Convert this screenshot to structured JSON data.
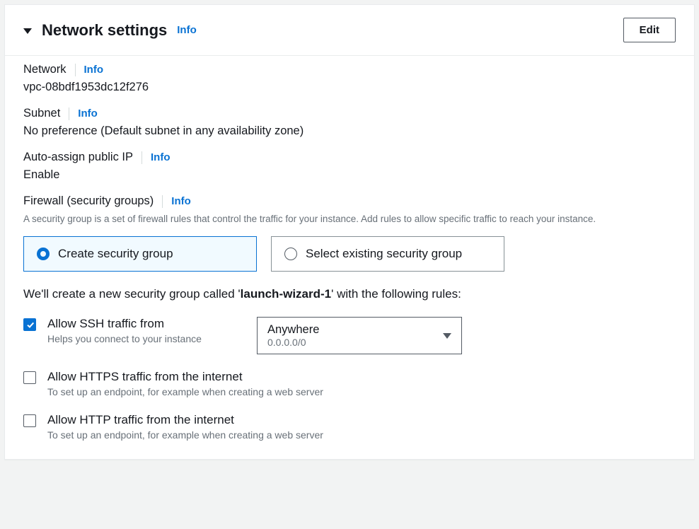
{
  "header": {
    "title": "Network settings",
    "info": "Info",
    "edit": "Edit"
  },
  "network": {
    "label": "Network",
    "info": "Info",
    "value": "vpc-08bdf1953dc12f276"
  },
  "subnet": {
    "label": "Subnet",
    "info": "Info",
    "value": "No preference (Default subnet in any availability zone)"
  },
  "publicIp": {
    "label": "Auto-assign public IP",
    "info": "Info",
    "value": "Enable"
  },
  "firewall": {
    "label": "Firewall (security groups)",
    "info": "Info",
    "desc": "A security group is a set of firewall rules that control the traffic for your instance. Add rules to allow specific traffic to reach your instance."
  },
  "sgOptions": {
    "create": "Create security group",
    "select": "Select existing security group"
  },
  "sgNote": {
    "prefix": "We'll create a new security group called '",
    "name": "launch-wizard-1",
    "suffix": "' with the following rules:"
  },
  "rules": {
    "ssh": {
      "label": "Allow SSH traffic from",
      "desc": "Helps you connect to your instance",
      "source": "Anywhere",
      "sourceDetail": "0.0.0.0/0"
    },
    "https": {
      "label": "Allow HTTPS traffic from the internet",
      "desc": "To set up an endpoint, for example when creating a web server"
    },
    "http": {
      "label": "Allow HTTP traffic from the internet",
      "desc": "To set up an endpoint, for example when creating a web server"
    }
  }
}
